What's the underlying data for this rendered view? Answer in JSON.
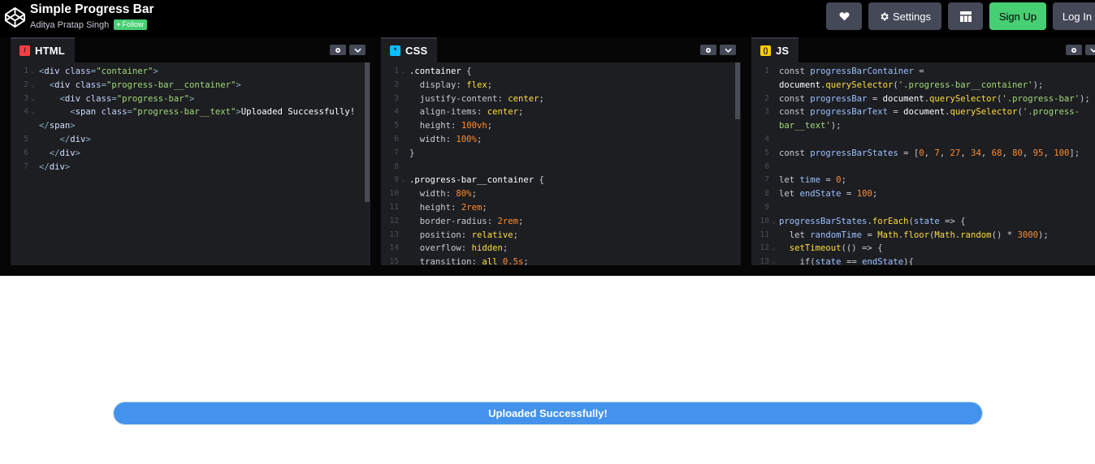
{
  "header": {
    "pen_title": "Simple Progress Bar",
    "author": "Aditya Pratap Singh",
    "follow_label": "Follow",
    "settings_label": "Settings",
    "signup_label": "Sign Up",
    "login_label": "Log In"
  },
  "editors": {
    "html": {
      "label": "HTML",
      "lines": [
        {
          "n": "1",
          "fold": true,
          "parts": [
            [
              "c-punc",
              "<"
            ],
            [
              "c-tag",
              "div "
            ],
            [
              "c-attr",
              "class"
            ],
            [
              "c-punc",
              "="
            ],
            [
              "c-str",
              "\"container\""
            ],
            [
              "c-punc",
              ">"
            ]
          ]
        },
        {
          "n": "2",
          "fold": true,
          "parts": [
            [
              "c-plain",
              "  "
            ],
            [
              "c-punc",
              "<"
            ],
            [
              "c-tag",
              "div "
            ],
            [
              "c-attr",
              "class"
            ],
            [
              "c-punc",
              "="
            ],
            [
              "c-str",
              "\"progress-bar__container\""
            ],
            [
              "c-punc",
              ">"
            ]
          ]
        },
        {
          "n": "3",
          "fold": true,
          "parts": [
            [
              "c-plain",
              "    "
            ],
            [
              "c-punc",
              "<"
            ],
            [
              "c-tag",
              "div "
            ],
            [
              "c-attr",
              "class"
            ],
            [
              "c-punc",
              "="
            ],
            [
              "c-str",
              "\"progress-bar\""
            ],
            [
              "c-punc",
              ">"
            ]
          ]
        },
        {
          "n": "4",
          "fold": true,
          "parts": [
            [
              "c-plain",
              "      "
            ],
            [
              "c-punc",
              "<"
            ],
            [
              "c-tag",
              "span "
            ],
            [
              "c-attr",
              "class"
            ],
            [
              "c-punc",
              "="
            ],
            [
              "c-str",
              "\"progress-bar__text\""
            ],
            [
              "c-punc",
              ">"
            ],
            [
              "c-text",
              "Uploaded Successfully!"
            ]
          ]
        },
        {
          "n": "",
          "fold": false,
          "parts": [
            [
              "c-punc",
              "</"
            ],
            [
              "c-tag",
              "span"
            ],
            [
              "c-punc",
              ">"
            ]
          ]
        },
        {
          "n": "5",
          "fold": false,
          "parts": [
            [
              "c-plain",
              "    "
            ],
            [
              "c-punc",
              "</"
            ],
            [
              "c-tag",
              "div"
            ],
            [
              "c-punc",
              ">"
            ]
          ]
        },
        {
          "n": "6",
          "fold": false,
          "parts": [
            [
              "c-plain",
              "  "
            ],
            [
              "c-punc",
              "</"
            ],
            [
              "c-tag",
              "div"
            ],
            [
              "c-punc",
              ">"
            ]
          ]
        },
        {
          "n": "7",
          "fold": false,
          "parts": [
            [
              "c-punc",
              "</"
            ],
            [
              "c-tag",
              "div"
            ],
            [
              "c-punc",
              ">"
            ]
          ]
        }
      ]
    },
    "css": {
      "label": "CSS",
      "lines": [
        {
          "n": "1",
          "fold": true,
          "parts": [
            [
              "c-sel",
              ".container "
            ],
            [
              "c-mute",
              "{"
            ]
          ]
        },
        {
          "n": "2",
          "fold": false,
          "parts": [
            [
              "c-plain",
              "  "
            ],
            [
              "c-prop",
              "display"
            ],
            [
              "c-mute",
              ": "
            ],
            [
              "c-val",
              "flex"
            ],
            [
              "c-mute",
              ";"
            ]
          ]
        },
        {
          "n": "3",
          "fold": false,
          "parts": [
            [
              "c-plain",
              "  "
            ],
            [
              "c-prop",
              "justify-content"
            ],
            [
              "c-mute",
              ": "
            ],
            [
              "c-val",
              "center"
            ],
            [
              "c-mute",
              ";"
            ]
          ]
        },
        {
          "n": "4",
          "fold": false,
          "parts": [
            [
              "c-plain",
              "  "
            ],
            [
              "c-prop",
              "align-items"
            ],
            [
              "c-mute",
              ": "
            ],
            [
              "c-val",
              "center"
            ],
            [
              "c-mute",
              ";"
            ]
          ]
        },
        {
          "n": "5",
          "fold": false,
          "parts": [
            [
              "c-plain",
              "  "
            ],
            [
              "c-prop",
              "height"
            ],
            [
              "c-mute",
              ": "
            ],
            [
              "c-num",
              "100vh"
            ],
            [
              "c-mute",
              ";"
            ]
          ]
        },
        {
          "n": "6",
          "fold": false,
          "parts": [
            [
              "c-plain",
              "  "
            ],
            [
              "c-prop",
              "width"
            ],
            [
              "c-mute",
              ": "
            ],
            [
              "c-num",
              "100%"
            ],
            [
              "c-mute",
              ";"
            ]
          ]
        },
        {
          "n": "7",
          "fold": false,
          "parts": [
            [
              "c-mute",
              "}"
            ]
          ]
        },
        {
          "n": "8",
          "fold": false,
          "parts": []
        },
        {
          "n": "9",
          "fold": true,
          "parts": [
            [
              "c-sel",
              ".progress-bar__container "
            ],
            [
              "c-mute",
              "{"
            ]
          ]
        },
        {
          "n": "10",
          "fold": false,
          "parts": [
            [
              "c-plain",
              "  "
            ],
            [
              "c-prop",
              "width"
            ],
            [
              "c-mute",
              ": "
            ],
            [
              "c-num",
              "80%"
            ],
            [
              "c-mute",
              ";"
            ]
          ]
        },
        {
          "n": "11",
          "fold": false,
          "parts": [
            [
              "c-plain",
              "  "
            ],
            [
              "c-prop",
              "height"
            ],
            [
              "c-mute",
              ": "
            ],
            [
              "c-num",
              "2rem"
            ],
            [
              "c-mute",
              ";"
            ]
          ]
        },
        {
          "n": "12",
          "fold": false,
          "parts": [
            [
              "c-plain",
              "  "
            ],
            [
              "c-prop",
              "border-radius"
            ],
            [
              "c-mute",
              ": "
            ],
            [
              "c-num",
              "2rem"
            ],
            [
              "c-mute",
              ";"
            ]
          ]
        },
        {
          "n": "13",
          "fold": false,
          "parts": [
            [
              "c-plain",
              "  "
            ],
            [
              "c-prop",
              "position"
            ],
            [
              "c-mute",
              ": "
            ],
            [
              "c-val",
              "relative"
            ],
            [
              "c-mute",
              ";"
            ]
          ]
        },
        {
          "n": "14",
          "fold": false,
          "parts": [
            [
              "c-plain",
              "  "
            ],
            [
              "c-prop",
              "overflow"
            ],
            [
              "c-mute",
              ": "
            ],
            [
              "c-val",
              "hidden"
            ],
            [
              "c-mute",
              ";"
            ]
          ]
        },
        {
          "n": "15",
          "fold": false,
          "parts": [
            [
              "c-plain",
              "  "
            ],
            [
              "c-prop",
              "transition"
            ],
            [
              "c-mute",
              ": "
            ],
            [
              "c-val",
              "all "
            ],
            [
              "c-num",
              "0.5s"
            ],
            [
              "c-mute",
              ";"
            ]
          ]
        }
      ]
    },
    "js": {
      "label": "JS",
      "lines": [
        {
          "n": "1",
          "fold": false,
          "parts": [
            [
              "c-kw",
              "const "
            ],
            [
              "c-var",
              "progressBarContainer"
            ],
            [
              "c-mute",
              " ="
            ]
          ]
        },
        {
          "n": "",
          "fold": false,
          "parts": [
            [
              "c-plain",
              "document"
            ],
            [
              "c-mute",
              "."
            ],
            [
              "c-fn",
              "querySelector"
            ],
            [
              "c-mute",
              "("
            ],
            [
              "c-jsstr",
              "'.progress-bar__container'"
            ],
            [
              "c-mute",
              ");"
            ]
          ]
        },
        {
          "n": "2",
          "fold": false,
          "parts": [
            [
              "c-kw",
              "const "
            ],
            [
              "c-var",
              "progressBar"
            ],
            [
              "c-mute",
              " = "
            ],
            [
              "c-plain",
              "document"
            ],
            [
              "c-mute",
              "."
            ],
            [
              "c-fn",
              "querySelector"
            ],
            [
              "c-mute",
              "("
            ],
            [
              "c-jsstr",
              "'.progress-bar'"
            ],
            [
              "c-mute",
              ");"
            ]
          ]
        },
        {
          "n": "3",
          "fold": false,
          "parts": [
            [
              "c-kw",
              "const "
            ],
            [
              "c-var",
              "progressBarText"
            ],
            [
              "c-mute",
              " = "
            ],
            [
              "c-plain",
              "document"
            ],
            [
              "c-mute",
              "."
            ],
            [
              "c-fn",
              "querySelector"
            ],
            [
              "c-mute",
              "("
            ],
            [
              "c-jsstr",
              "'.progress-"
            ]
          ]
        },
        {
          "n": "",
          "fold": false,
          "parts": [
            [
              "c-jsstr",
              "bar__text'"
            ],
            [
              "c-mute",
              ");"
            ]
          ]
        },
        {
          "n": "4",
          "fold": false,
          "parts": []
        },
        {
          "n": "5",
          "fold": false,
          "parts": [
            [
              "c-kw",
              "const "
            ],
            [
              "c-var",
              "progressBarStates"
            ],
            [
              "c-mute",
              " = ["
            ],
            [
              "c-num",
              "0"
            ],
            [
              "c-mute",
              ", "
            ],
            [
              "c-num",
              "7"
            ],
            [
              "c-mute",
              ", "
            ],
            [
              "c-num",
              "27"
            ],
            [
              "c-mute",
              ", "
            ],
            [
              "c-num",
              "34"
            ],
            [
              "c-mute",
              ", "
            ],
            [
              "c-num",
              "68"
            ],
            [
              "c-mute",
              ", "
            ],
            [
              "c-num",
              "80"
            ],
            [
              "c-mute",
              ", "
            ],
            [
              "c-num",
              "95"
            ],
            [
              "c-mute",
              ", "
            ],
            [
              "c-num",
              "100"
            ],
            [
              "c-mute",
              "];"
            ]
          ]
        },
        {
          "n": "6",
          "fold": false,
          "parts": []
        },
        {
          "n": "7",
          "fold": false,
          "parts": [
            [
              "c-kw",
              "let "
            ],
            [
              "c-var",
              "time"
            ],
            [
              "c-mute",
              " = "
            ],
            [
              "c-num",
              "0"
            ],
            [
              "c-mute",
              ";"
            ]
          ]
        },
        {
          "n": "8",
          "fold": false,
          "parts": [
            [
              "c-kw",
              "let "
            ],
            [
              "c-var",
              "endState"
            ],
            [
              "c-mute",
              " = "
            ],
            [
              "c-num",
              "100"
            ],
            [
              "c-mute",
              ";"
            ]
          ]
        },
        {
          "n": "9",
          "fold": false,
          "parts": []
        },
        {
          "n": "10",
          "fold": true,
          "parts": [
            [
              "c-var",
              "progressBarStates"
            ],
            [
              "c-mute",
              "."
            ],
            [
              "c-fn",
              "forEach"
            ],
            [
              "c-mute",
              "("
            ],
            [
              "c-var",
              "state"
            ],
            [
              "c-mute",
              " => {"
            ]
          ]
        },
        {
          "n": "11",
          "fold": false,
          "parts": [
            [
              "c-plain",
              "  "
            ],
            [
              "c-kw",
              "let "
            ],
            [
              "c-var",
              "randomTime"
            ],
            [
              "c-mute",
              " = "
            ],
            [
              "c-fn",
              "Math"
            ],
            [
              "c-mute",
              "."
            ],
            [
              "c-fn",
              "floor"
            ],
            [
              "c-mute",
              "("
            ],
            [
              "c-fn",
              "Math"
            ],
            [
              "c-mute",
              "."
            ],
            [
              "c-fn",
              "random"
            ],
            [
              "c-mute",
              "() * "
            ],
            [
              "c-num",
              "3000"
            ],
            [
              "c-mute",
              ");"
            ]
          ]
        },
        {
          "n": "12",
          "fold": true,
          "parts": [
            [
              "c-plain",
              "  "
            ],
            [
              "c-fn",
              "setTimeout"
            ],
            [
              "c-mute",
              "(() => {"
            ]
          ]
        },
        {
          "n": "13",
          "fold": true,
          "parts": [
            [
              "c-plain",
              "    "
            ],
            [
              "c-kw",
              "if"
            ],
            [
              "c-mute",
              "("
            ],
            [
              "c-var",
              "state"
            ],
            [
              "c-mute",
              " == "
            ],
            [
              "c-var",
              "endState"
            ],
            [
              "c-mute",
              "){"
            ]
          ]
        }
      ]
    }
  },
  "preview": {
    "progress_text": "Uploaded Successfully!",
    "progress_percent": 100
  },
  "colors": {
    "accent_green": "#47cf73",
    "progress_blue": "#4392eb"
  }
}
